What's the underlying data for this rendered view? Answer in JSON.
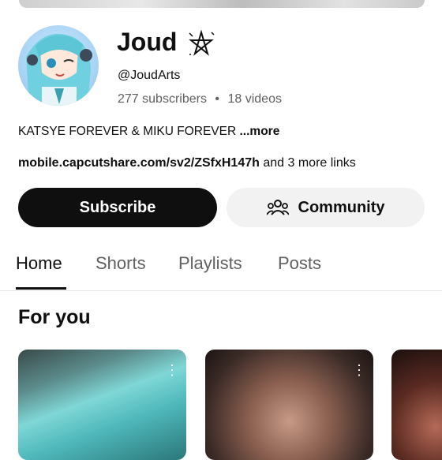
{
  "channel": {
    "name": "Joud",
    "handle": "@JoudArts",
    "subscribers": "277 subscribers",
    "separator": "•",
    "videos": "18 videos",
    "description": "KATSYE FOREVER & MIKU FOREVER",
    "more_label": "...more",
    "link_url": "mobile.capcutshare.com/sv2/ZSfxH147h",
    "more_links": "and 3 more links"
  },
  "actions": {
    "subscribe_label": "Subscribe",
    "community_label": "Community"
  },
  "tabs": [
    {
      "label": "Home",
      "active": true
    },
    {
      "label": "Shorts",
      "active": false
    },
    {
      "label": "Playlists",
      "active": false
    },
    {
      "label": "Posts",
      "active": false
    }
  ],
  "sections": {
    "for_you_title": "For you"
  },
  "icons": {
    "name_symbol": "pentagram-icon",
    "community": "people-icon",
    "card_menu": "kebab-menu-icon"
  },
  "colors": {
    "subscribe_bg": "#0f0f0f",
    "community_bg": "#f2f2f2",
    "secondary_text": "#606060"
  }
}
